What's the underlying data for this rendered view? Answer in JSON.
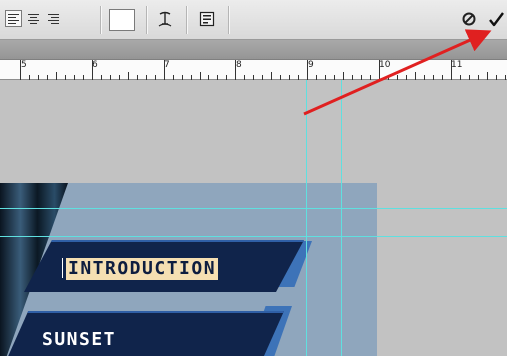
{
  "options_bar": {
    "tools": [
      {
        "name": "align-left",
        "icon": "align-left-icon",
        "active": true
      },
      {
        "name": "align-center",
        "icon": "align-center-icon",
        "active": false
      },
      {
        "name": "align-right",
        "icon": "align-right-icon",
        "active": false
      }
    ],
    "text_color": "#ffffff",
    "warp_icon": "warp-text-icon",
    "panels_icon": "character-paragraph-panels-icon",
    "cancel_icon": "cancel-icon",
    "commit_icon": "commit-checkmark-icon"
  },
  "ruler": {
    "labels": [
      "5",
      "6",
      "7",
      "8",
      "9",
      "10",
      "11"
    ]
  },
  "canvas": {
    "nav_items": [
      {
        "label": "INTRODUCTION",
        "selected": true
      },
      {
        "label": "SUNSET",
        "selected": false
      }
    ],
    "colors": {
      "button_fill": "#10244b",
      "button_accent": "#3d73b8",
      "selection": "#f5dfb2",
      "guide": "#5fe0e0",
      "arrow": "#e02020",
      "doc_background": "#8fa6bd"
    }
  }
}
